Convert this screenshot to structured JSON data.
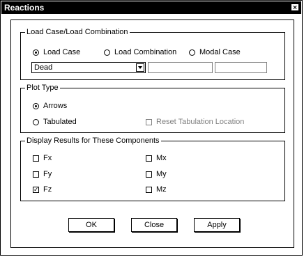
{
  "window": {
    "title": "Reactions",
    "close_glyph": "×"
  },
  "load_group": {
    "legend": "Load Case/Load Combination",
    "options": [
      {
        "label": "Load Case",
        "selected": true
      },
      {
        "label": "Load Combination",
        "selected": false
      },
      {
        "label": "Modal Case",
        "selected": false
      }
    ],
    "combo_value": "Dead",
    "text_field_1": "",
    "text_field_2": ""
  },
  "plot_group": {
    "legend": "Plot Type",
    "arrows_label": "Arrows",
    "arrows_selected": true,
    "tabulated_label": "Tabulated",
    "tabulated_selected": false,
    "reset_label": "Reset Tabulation Location",
    "reset_checked": false
  },
  "components_group": {
    "legend": "Display Results for These Components",
    "fx": {
      "label": "Fx",
      "checked": false
    },
    "fy": {
      "label": "Fy",
      "checked": false
    },
    "fz": {
      "label": "Fz",
      "checked": true
    },
    "mx": {
      "label": "Mx",
      "checked": false
    },
    "my": {
      "label": "My",
      "checked": false
    },
    "mz": {
      "label": "Mz",
      "checked": false
    }
  },
  "buttons": {
    "ok": "OK",
    "close": "Close",
    "apply": "Apply"
  }
}
